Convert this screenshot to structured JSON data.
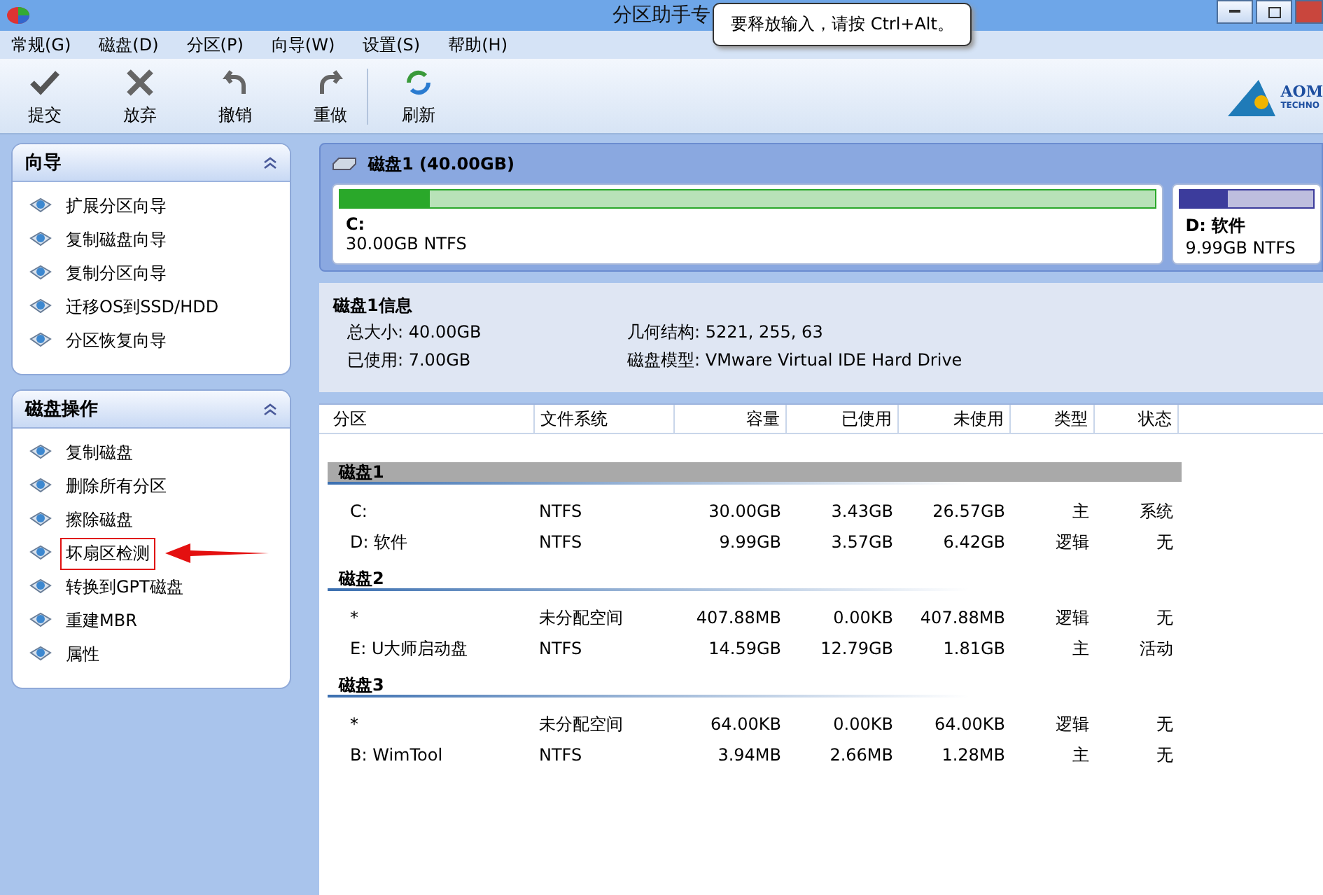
{
  "window": {
    "title": "分区助手专"
  },
  "tooltip": {
    "text": "要释放输入，请按 Ctrl+Alt。"
  },
  "menu": [
    "常规(G)",
    "磁盘(D)",
    "分区(P)",
    "向导(W)",
    "设置(S)",
    "帮助(H)"
  ],
  "toolbar": [
    {
      "kind": "check",
      "label": "提交"
    },
    {
      "kind": "cross",
      "label": "放弃"
    },
    {
      "kind": "undo",
      "label": "撤销"
    },
    {
      "kind": "redo",
      "label": "重做"
    },
    {
      "kind": "refresh",
      "label": "刷新"
    }
  ],
  "logo": {
    "name": "AOM",
    "sub": "TECHNO"
  },
  "sidebar": [
    {
      "title": "向导",
      "expanded": true,
      "items": [
        {
          "label": "扩展分区向导",
          "highlighted": false
        },
        {
          "label": "复制磁盘向导",
          "highlighted": false
        },
        {
          "label": "复制分区向导",
          "highlighted": false
        },
        {
          "label": "迁移OS到SSD/HDD",
          "highlighted": false
        },
        {
          "label": "分区恢复向导",
          "highlighted": false
        }
      ]
    },
    {
      "title": "磁盘操作",
      "expanded": true,
      "items": [
        {
          "label": "复制磁盘",
          "highlighted": false
        },
        {
          "label": "删除所有分区",
          "highlighted": false
        },
        {
          "label": "擦除磁盘",
          "highlighted": false
        },
        {
          "label": "坏扇区检测",
          "highlighted": true
        },
        {
          "label": "转换到GPT磁盘",
          "highlighted": false
        },
        {
          "label": "重建MBR",
          "highlighted": false
        },
        {
          "label": "属性",
          "highlighted": false
        }
      ]
    }
  ],
  "disk_map": {
    "title": "磁盘1 (40.00GB)",
    "partitions": [
      {
        "name": "C:",
        "detail": "30.00GB NTFS",
        "color": "#2aa82a",
        "level": 0.11
      },
      {
        "name": "D: 软件",
        "detail": "9.99GB NTFS",
        "color": "#3c3c9c",
        "level": 0.36
      }
    ]
  },
  "disk_info": {
    "title": "磁盘1信息",
    "fields": [
      {
        "label": "总大小: 40.00GB"
      },
      {
        "label": "几何结构: 5221, 255, 63"
      },
      {
        "label": "已使用: 7.00GB"
      },
      {
        "label": "磁盘模型: VMware Virtual IDE Hard Drive"
      }
    ]
  },
  "table": {
    "columns": [
      "分区",
      "文件系统",
      "容量",
      "已使用",
      "未使用",
      "类型",
      "状态"
    ],
    "groups": [
      {
        "name": "磁盘1",
        "selected": true,
        "rows": [
          [
            "C:",
            "NTFS",
            "30.00GB",
            "3.43GB",
            "26.57GB",
            "主",
            "系统"
          ],
          [
            "D: 软件",
            "NTFS",
            "9.99GB",
            "3.57GB",
            "6.42GB",
            "逻辑",
            "无"
          ]
        ]
      },
      {
        "name": "磁盘2",
        "selected": false,
        "rows": [
          [
            "*",
            "未分配空间",
            "407.88MB",
            "0.00KB",
            "407.88MB",
            "逻辑",
            "无"
          ],
          [
            "E: U大师启动盘",
            "NTFS",
            "14.59GB",
            "12.79GB",
            "1.81GB",
            "主",
            "活动"
          ]
        ]
      },
      {
        "name": "磁盘3",
        "selected": false,
        "rows": [
          [
            "*",
            "未分配空间",
            "64.00KB",
            "0.00KB",
            "64.00KB",
            "逻辑",
            "无"
          ],
          [
            "B: WimTool",
            "NTFS",
            "3.94MB",
            "2.66MB",
            "1.28MB",
            "主",
            "无"
          ]
        ]
      }
    ]
  }
}
